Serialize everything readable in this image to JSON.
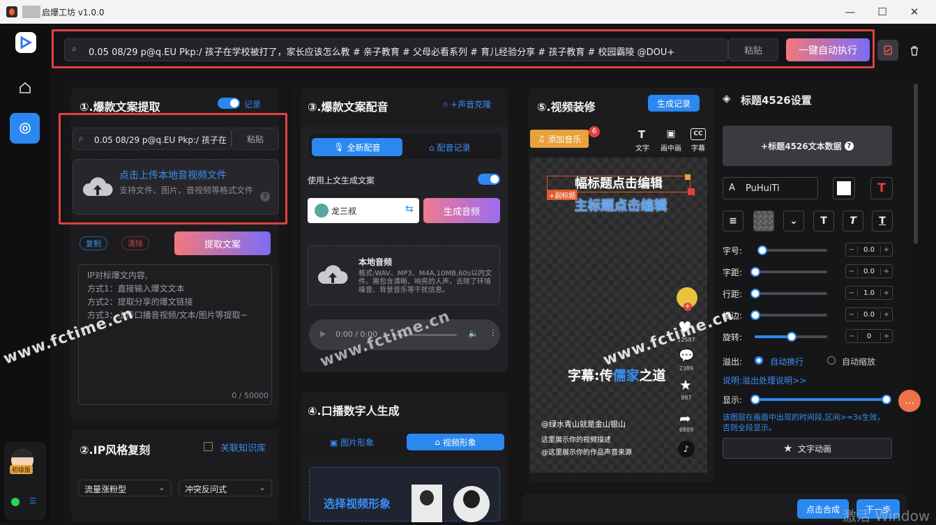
{
  "window": {
    "title": "启爆工坊 v1.0.0",
    "minimize": "—",
    "maximize": "☐",
    "close": "✕"
  },
  "rail": {
    "badge": "初级版"
  },
  "topbar": {
    "link_text": "0.05 08/29 p@q.EU Pkp:/ 孩子在学校被打了，家长应该怎么教 # 亲子教育 # 父母必看系列 # 育儿经验分享 # 孩子教育 # 校园霸陵 @DOU+",
    "paste": "粘贴",
    "run": "一键自动执行"
  },
  "p1": {
    "title": "①.爆款文案提取",
    "record": "记录",
    "link_text": "0.05 08/29 p@q.EU Pkp:/ 孩子在",
    "paste": "粘贴",
    "upload_title": "点击上传本地音视频文件",
    "upload_sub": "支持文件、图片、音视频等格式文件",
    "copy": "复制",
    "clear": "清除",
    "extract": "提取文案",
    "placeholder": "IP对标爆文内容,\n方式1：直接输入爆文文本\n方式2：提取分享的爆文链接\n方式3：上传口播音视频/文本/图片等提取~",
    "counter": "0 / 50000"
  },
  "p2": {
    "title": "②.IP风格复刻",
    "kb": "关联知识库",
    "select1": "流量涨粉型",
    "select2": "冲突反问式"
  },
  "p3": {
    "title": "③.爆款文案配音",
    "clone": "+声音克隆",
    "tab_new": "全新配音",
    "tab_record": "配音记录",
    "use_above": "使用上文生成文案",
    "voice": "龙三叔",
    "generate": "生成音频",
    "local_title": "本地音频",
    "local_desc": "格式:WAV、MP3、M4A,10MB,60s以内文件。需包含清晰、响亮的人声，去除了环境噪音、背景音乐等干扰信息。",
    "time": "0:00 / 0:00"
  },
  "p4": {
    "title": "④.口播数字人生成",
    "tab_image": "图片形象",
    "tab_video": "视频形象",
    "select": "选择视频形象"
  },
  "p5": {
    "title": "⑤.视频装修",
    "history": "生成记录",
    "add_music": "添加音乐",
    "music_badge": "6",
    "tool_text": "文字",
    "tool_pip": "画中画",
    "tool_caption": "字幕",
    "preview_title1": "幅标题点击编辑",
    "preview_title2": "主标题点击编辑",
    "preview_subtag": "+副标题",
    "caption_a": "字幕:传",
    "caption_b": "儒家",
    "caption_c": "之道",
    "likes": "12587",
    "comments": "2389",
    "stars": "987",
    "shares": "6889",
    "account": "@绿水青山就是金山银山",
    "desc1": "这里展示你的视频描述",
    "desc2": "@这里展示你的作品声音来源",
    "synth": "点击合成",
    "next": "下一步"
  },
  "settings": {
    "title": "标题4526设置",
    "add_data": "+标题4526文本数据",
    "font": "PuHuiTi",
    "font_size": "字号:",
    "spacing": "字距:",
    "line_height": "行距:",
    "stroke": "描边:",
    "rotate": "旋转:",
    "v_size": "0.0",
    "v_spacing": "0.0",
    "v_line": "1.0",
    "v_stroke": "0.0",
    "v_rotate": "0",
    "overflow": "溢出:",
    "auto_wrap": "自动换行",
    "auto_scale": "自动缩放",
    "overflow_help": "说明:溢出处理说明>>",
    "display": "显示:",
    "display_help": "该图层在画面中出现的时间段,区间>=3s生效，否则全段显示。",
    "animation": "文字动画"
  },
  "watermarks": [
    "www.fctime.cn",
    "www.fctime.cn",
    "www.fctime.cn"
  ],
  "activation": "激活 Window",
  "colors": {
    "accent": "#2b88f0",
    "danger": "#e0423f",
    "gradient_start": "#f2787c",
    "gradient_end": "#7d6cf5"
  }
}
